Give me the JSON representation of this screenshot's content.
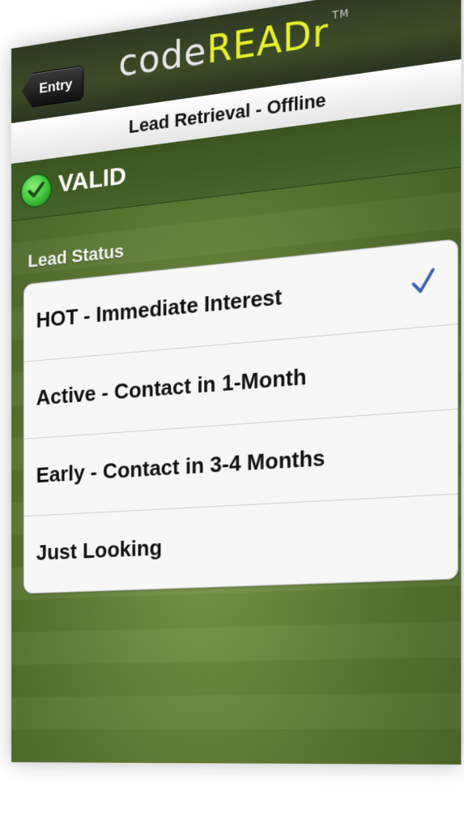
{
  "nav": {
    "back_label": "Entry",
    "logo_code": "code",
    "logo_reader": "READr",
    "logo_tm": "TM"
  },
  "header": {
    "title": "Lead Retrieval - Offline"
  },
  "scan": {
    "status": "VALID"
  },
  "lead_status": {
    "label": "Lead Status",
    "options": [
      {
        "label": "HOT - Immediate Interest",
        "selected": true
      },
      {
        "label": "Active - Contact in 1-Month",
        "selected": false
      },
      {
        "label": "Early - Contact in 3-4 Months",
        "selected": false
      },
      {
        "label": "Just Looking",
        "selected": false
      }
    ]
  },
  "colors": {
    "accent_yellow": "#e7f12a",
    "valid_green": "#3cc23a",
    "check_blue": "#3a63b5",
    "background_green": "#5c7a34"
  },
  "icons": {
    "valid": "check-circle-icon",
    "selected": "checkmark-icon",
    "back": "chevron-left-icon"
  }
}
